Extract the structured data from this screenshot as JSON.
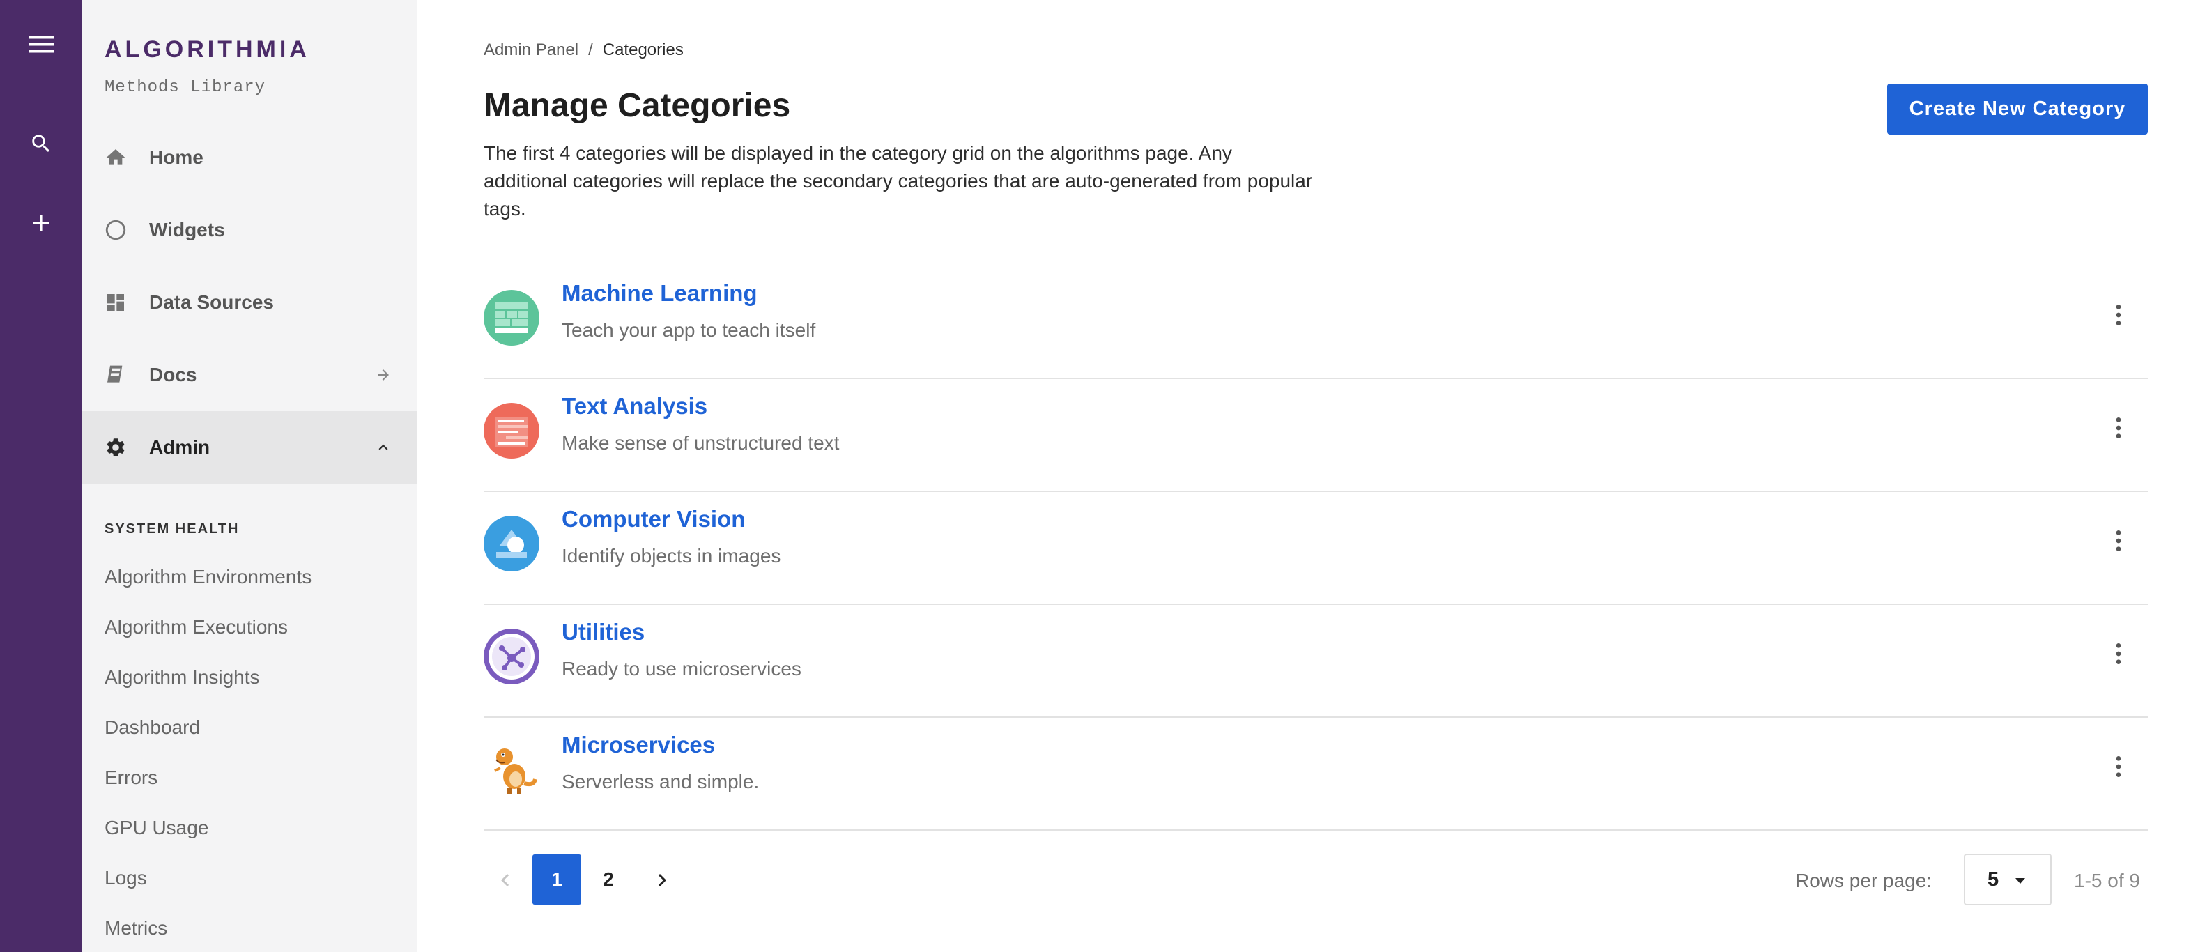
{
  "rail": {
    "icons": [
      "menu-icon",
      "search-icon",
      "plus-icon"
    ],
    "background": "#4b2b68"
  },
  "sidebar": {
    "brand": "ALGORITHMIA",
    "subtitle": "Methods Library",
    "nav": [
      {
        "label": "Home",
        "icon": "home-icon"
      },
      {
        "label": "Widgets",
        "icon": "circle-icon"
      },
      {
        "label": "Data Sources",
        "icon": "dashboard-grid-icon"
      },
      {
        "label": "Docs",
        "icon": "book-icon",
        "trail": "arrow-right-icon"
      },
      {
        "label": "Admin",
        "icon": "gear-icon",
        "trail": "chevron-up-icon",
        "active": true
      }
    ],
    "section_heading": "SYSTEM HEALTH",
    "sub_items": [
      "Algorithm Environments",
      "Algorithm Executions",
      "Algorithm Insights",
      "Dashboard",
      "Errors",
      "GPU Usage",
      "Logs",
      "Metrics"
    ]
  },
  "main": {
    "breadcrumb": {
      "parent": "Admin Panel",
      "separator": "/",
      "current": "Categories"
    },
    "title": "Manage Categories",
    "description": "The first 4 categories will be displayed in the category grid on the algorithms page. Any additional categories will replace the secondary categories that are auto-generated from popular tags.",
    "create_button": "Create New Category",
    "categories": [
      {
        "name": "Machine Learning",
        "description": "Teach your app to teach itself",
        "icon": "machine-learning-icon",
        "color": "#5cc49a"
      },
      {
        "name": "Text Analysis",
        "description": "Make sense of unstructured text",
        "icon": "text-analysis-icon",
        "color": "#ee6a5a"
      },
      {
        "name": "Computer Vision",
        "description": "Identify objects in images",
        "icon": "computer-vision-icon",
        "color": "#3a9ee0"
      },
      {
        "name": "Utilities",
        "description": "Ready to use microservices",
        "icon": "utilities-icon",
        "color": "#7a5bbe"
      },
      {
        "name": "Microservices",
        "description": "Serverless and simple.",
        "icon": "dinosaur-mascot-icon",
        "color": "#e8922e"
      }
    ],
    "pagination": {
      "pages": [
        "1",
        "2"
      ],
      "current_page": "1",
      "rows_label": "Rows per page:",
      "rows_value": "5",
      "range": "1-5 of 9"
    },
    "accent": "#1f63d6"
  }
}
